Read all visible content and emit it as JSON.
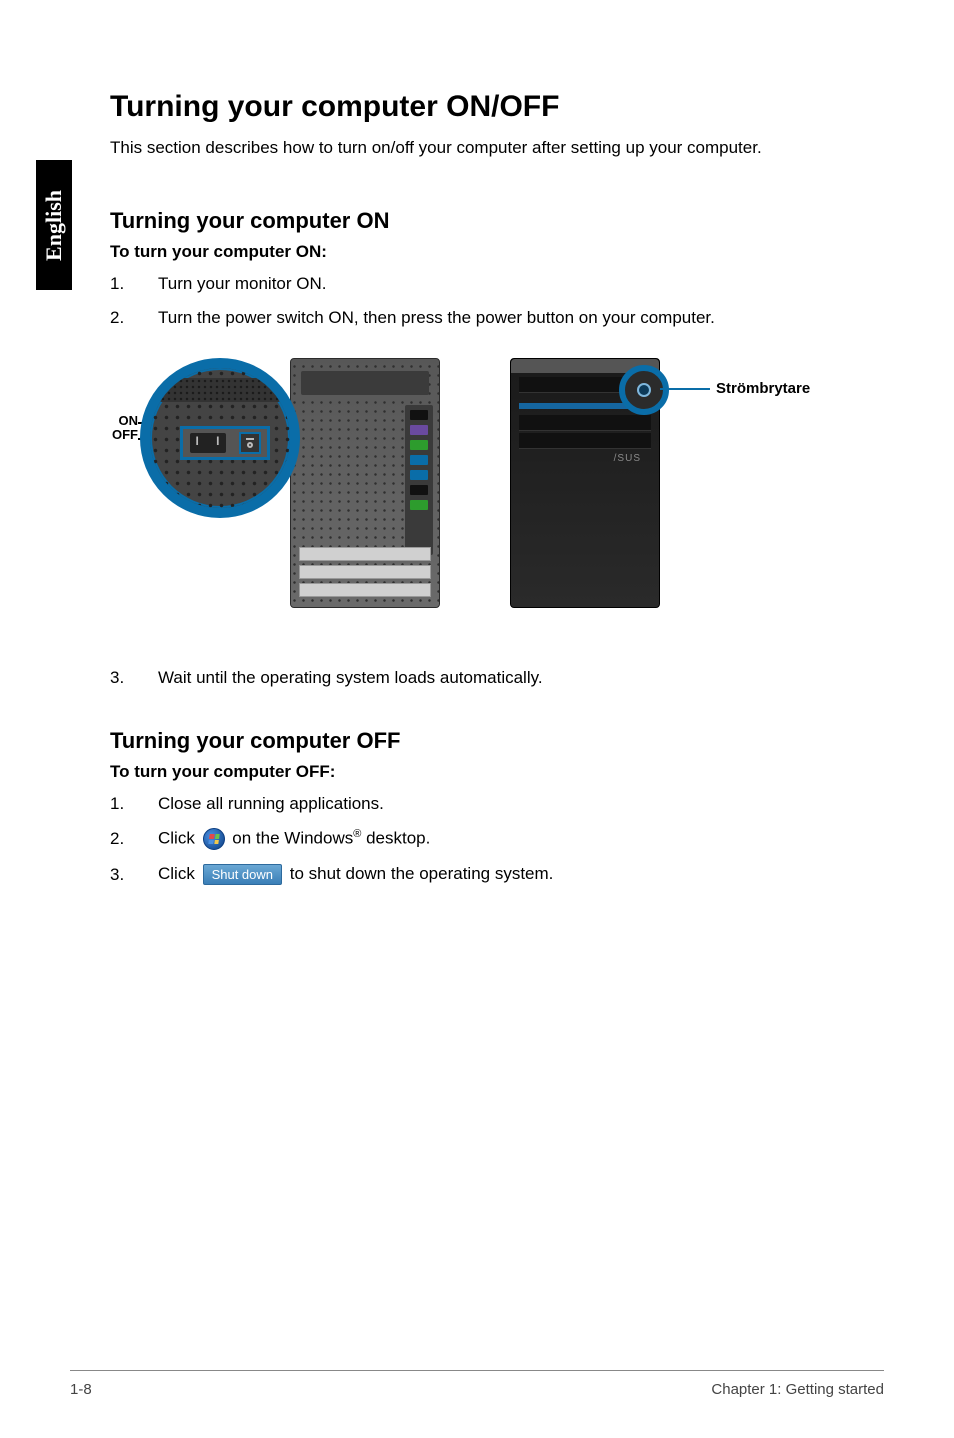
{
  "side_tab": "English",
  "h1": "Turning your computer ON/OFF",
  "intro": "This section describes how to turn on/off your computer after setting up your computer.",
  "on": {
    "heading": "Turning your computer ON",
    "subhead": "To turn your computer ON:",
    "steps": [
      {
        "n": "1.",
        "t": "Turn your monitor ON."
      },
      {
        "n": "2.",
        "t": "Turn the power switch ON, then press the power button on your computer."
      },
      {
        "n": "3.",
        "t": "Wait until the operating system loads automatically."
      }
    ],
    "labels": {
      "on": "ON",
      "off": "OFF",
      "power_callout": "Strömbrytare",
      "logo": "/SUS"
    }
  },
  "off": {
    "heading": "Turning your computer OFF",
    "subhead": "To turn your computer OFF:",
    "steps": {
      "s1": {
        "n": "1.",
        "t": "Close all running applications."
      },
      "s2": {
        "n": "2.",
        "pre": "Click ",
        "post_a": " on the Windows",
        "post_b": " desktop."
      },
      "s3": {
        "n": "3.",
        "pre": "Click ",
        "btn": "Shut down",
        "post": " to shut down the operating system."
      }
    },
    "reg": "®"
  },
  "footer": {
    "left": "1-8",
    "right": "Chapter 1: Getting started"
  }
}
